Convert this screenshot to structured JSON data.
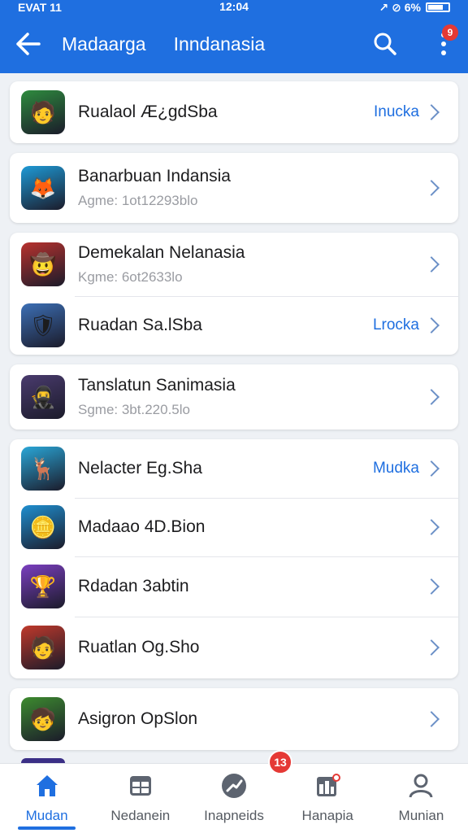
{
  "status_bar": {
    "left": "EVAT 11",
    "time": "12:04",
    "right": "↗ ⊘ 6%"
  },
  "app_bar": {
    "title_primary": "Madaarga",
    "title_secondary": "Inndanasia",
    "more_badge": "9",
    "icons": {
      "back": "back-arrow-icon",
      "search": "search-icon",
      "more": "more-vertical-icon"
    }
  },
  "cards": [
    {
      "rows": [
        {
          "title": "Rualaol Æ¿gdSba",
          "subtitle": "",
          "action": "Inucka",
          "icon": "game-icon",
          "bg": "#2e8b3e",
          "glyph": "🧑"
        }
      ]
    },
    {
      "rows": [
        {
          "title": "Banarbuan Indansia",
          "subtitle": "Agme: 1ot12293blo",
          "action": "",
          "icon": "game-icon",
          "bg": "#1e9ad6",
          "glyph": "🦊"
        }
      ]
    },
    {
      "rows": [
        {
          "title": "Demekalan Nelanasia",
          "subtitle": "Kgme: 6ot2633lo",
          "action": "",
          "icon": "game-icon",
          "bg": "#b8322e",
          "glyph": "🤠"
        },
        {
          "title": "Ruadan Sa.lSba",
          "subtitle": "",
          "action": "Lrocka",
          "icon": "game-icon",
          "bg": "#3c6fb5",
          "glyph": "🛡"
        }
      ]
    },
    {
      "rows": [
        {
          "title": "Tanslatun Sanimasia",
          "subtitle": "Sgme: 3bt.220.5lo",
          "action": "",
          "icon": "game-icon",
          "bg": "#4a3b6e",
          "glyph": "🥷"
        }
      ]
    },
    {
      "rows": [
        {
          "title": "Nelacter Eg.Sha",
          "subtitle": "",
          "action": "Mudka",
          "icon": "game-icon",
          "bg": "#2aa7d8",
          "glyph": "🦌"
        },
        {
          "title": "Madaao 4D.Bion",
          "subtitle": "",
          "action": "",
          "icon": "game-icon",
          "bg": "#1f8fd0",
          "glyph": "🪙"
        },
        {
          "title": "Rdadan 3abtin",
          "subtitle": "",
          "action": "",
          "icon": "game-icon",
          "bg": "#7b3fc0",
          "glyph": "🏆"
        },
        {
          "title": "Ruatlan Og.Sho",
          "subtitle": "",
          "action": "",
          "icon": "game-icon",
          "bg": "#c0392b",
          "glyph": "🧑"
        }
      ]
    },
    {
      "rows": [
        {
          "title": "Asigron OpSlon",
          "subtitle": "",
          "action": "",
          "icon": "game-icon",
          "bg": "#3d8b2f",
          "glyph": "🧒"
        }
      ]
    }
  ],
  "bottom_nav": [
    {
      "label": "Mudan",
      "icon": "home-icon",
      "active": true
    },
    {
      "label": "Nedanein",
      "icon": "calendar-icon",
      "active": false
    },
    {
      "label": "Inapneids",
      "icon": "compass-icon",
      "active": false
    },
    {
      "label": "Hanapia",
      "icon": "dashboard-icon",
      "active": false
    },
    {
      "label": "Munian",
      "icon": "person-icon",
      "active": false
    }
  ],
  "nav_badge": "13",
  "colors": {
    "accent": "#1f6fe0",
    "badge": "#e53935"
  }
}
